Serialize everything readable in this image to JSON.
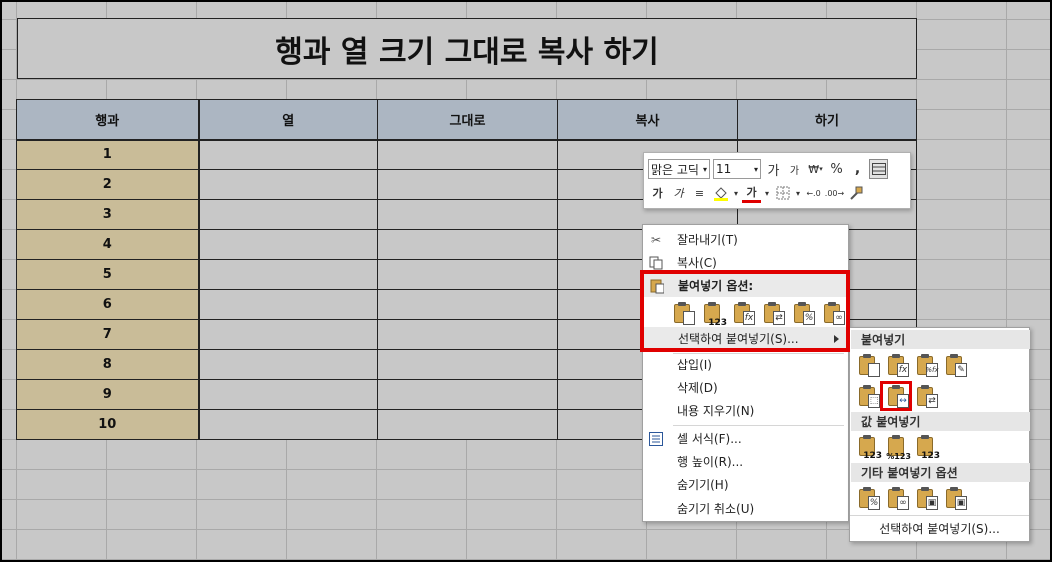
{
  "title": "행과 열 크기 그대로 복사 하기",
  "table": {
    "headers": [
      "행과",
      "열",
      "그대로",
      "복사",
      "하기"
    ],
    "rows": [
      "1",
      "2",
      "3",
      "4",
      "5",
      "6",
      "7",
      "8",
      "9",
      "10"
    ]
  },
  "mini_toolbar": {
    "font_name": "맑은 고딕",
    "font_size": "11",
    "row1_buttons": [
      "가",
      "가",
      "₩",
      "%",
      ","
    ],
    "row2_buttons": [
      "가",
      "가",
      "≡",
      "가"
    ]
  },
  "context_menu": {
    "items": [
      {
        "label": "잘라내기(T)",
        "icon": "scissors-icon"
      },
      {
        "label": "복사(C)",
        "icon": "copy-icon"
      },
      {
        "label": "붙여넣기 옵션:",
        "icon": "paste-icon"
      },
      {
        "label": "선택하여 붙여넣기(S)...",
        "icon": ""
      },
      {
        "label": "삽입(I)",
        "icon": ""
      },
      {
        "label": "삭제(D)",
        "icon": ""
      },
      {
        "label": "내용 지우기(N)",
        "icon": ""
      },
      {
        "label": "셀 서식(F)...",
        "icon": "format-cells-icon"
      },
      {
        "label": "행 높이(R)...",
        "icon": ""
      },
      {
        "label": "숨기기(H)",
        "icon": ""
      },
      {
        "label": "숨기기 취소(U)",
        "icon": ""
      }
    ],
    "paste_option_subs": [
      "",
      "123",
      "fx",
      "⇄",
      "%",
      "∞"
    ]
  },
  "submenu": {
    "headers": [
      "붙여넣기",
      "값 붙여넣기",
      "기타 붙여넣기 옵션"
    ],
    "paste_row1": [
      "",
      "fx",
      "%fx",
      "✎"
    ],
    "paste_row2": [
      "⬚",
      "↔",
      "⇄"
    ],
    "values_row": [
      "123",
      "%123",
      "123"
    ],
    "other_row": [
      "%",
      "∞",
      "▣",
      "▣"
    ],
    "footer": "선택하여 붙여넣기(S)..."
  }
}
